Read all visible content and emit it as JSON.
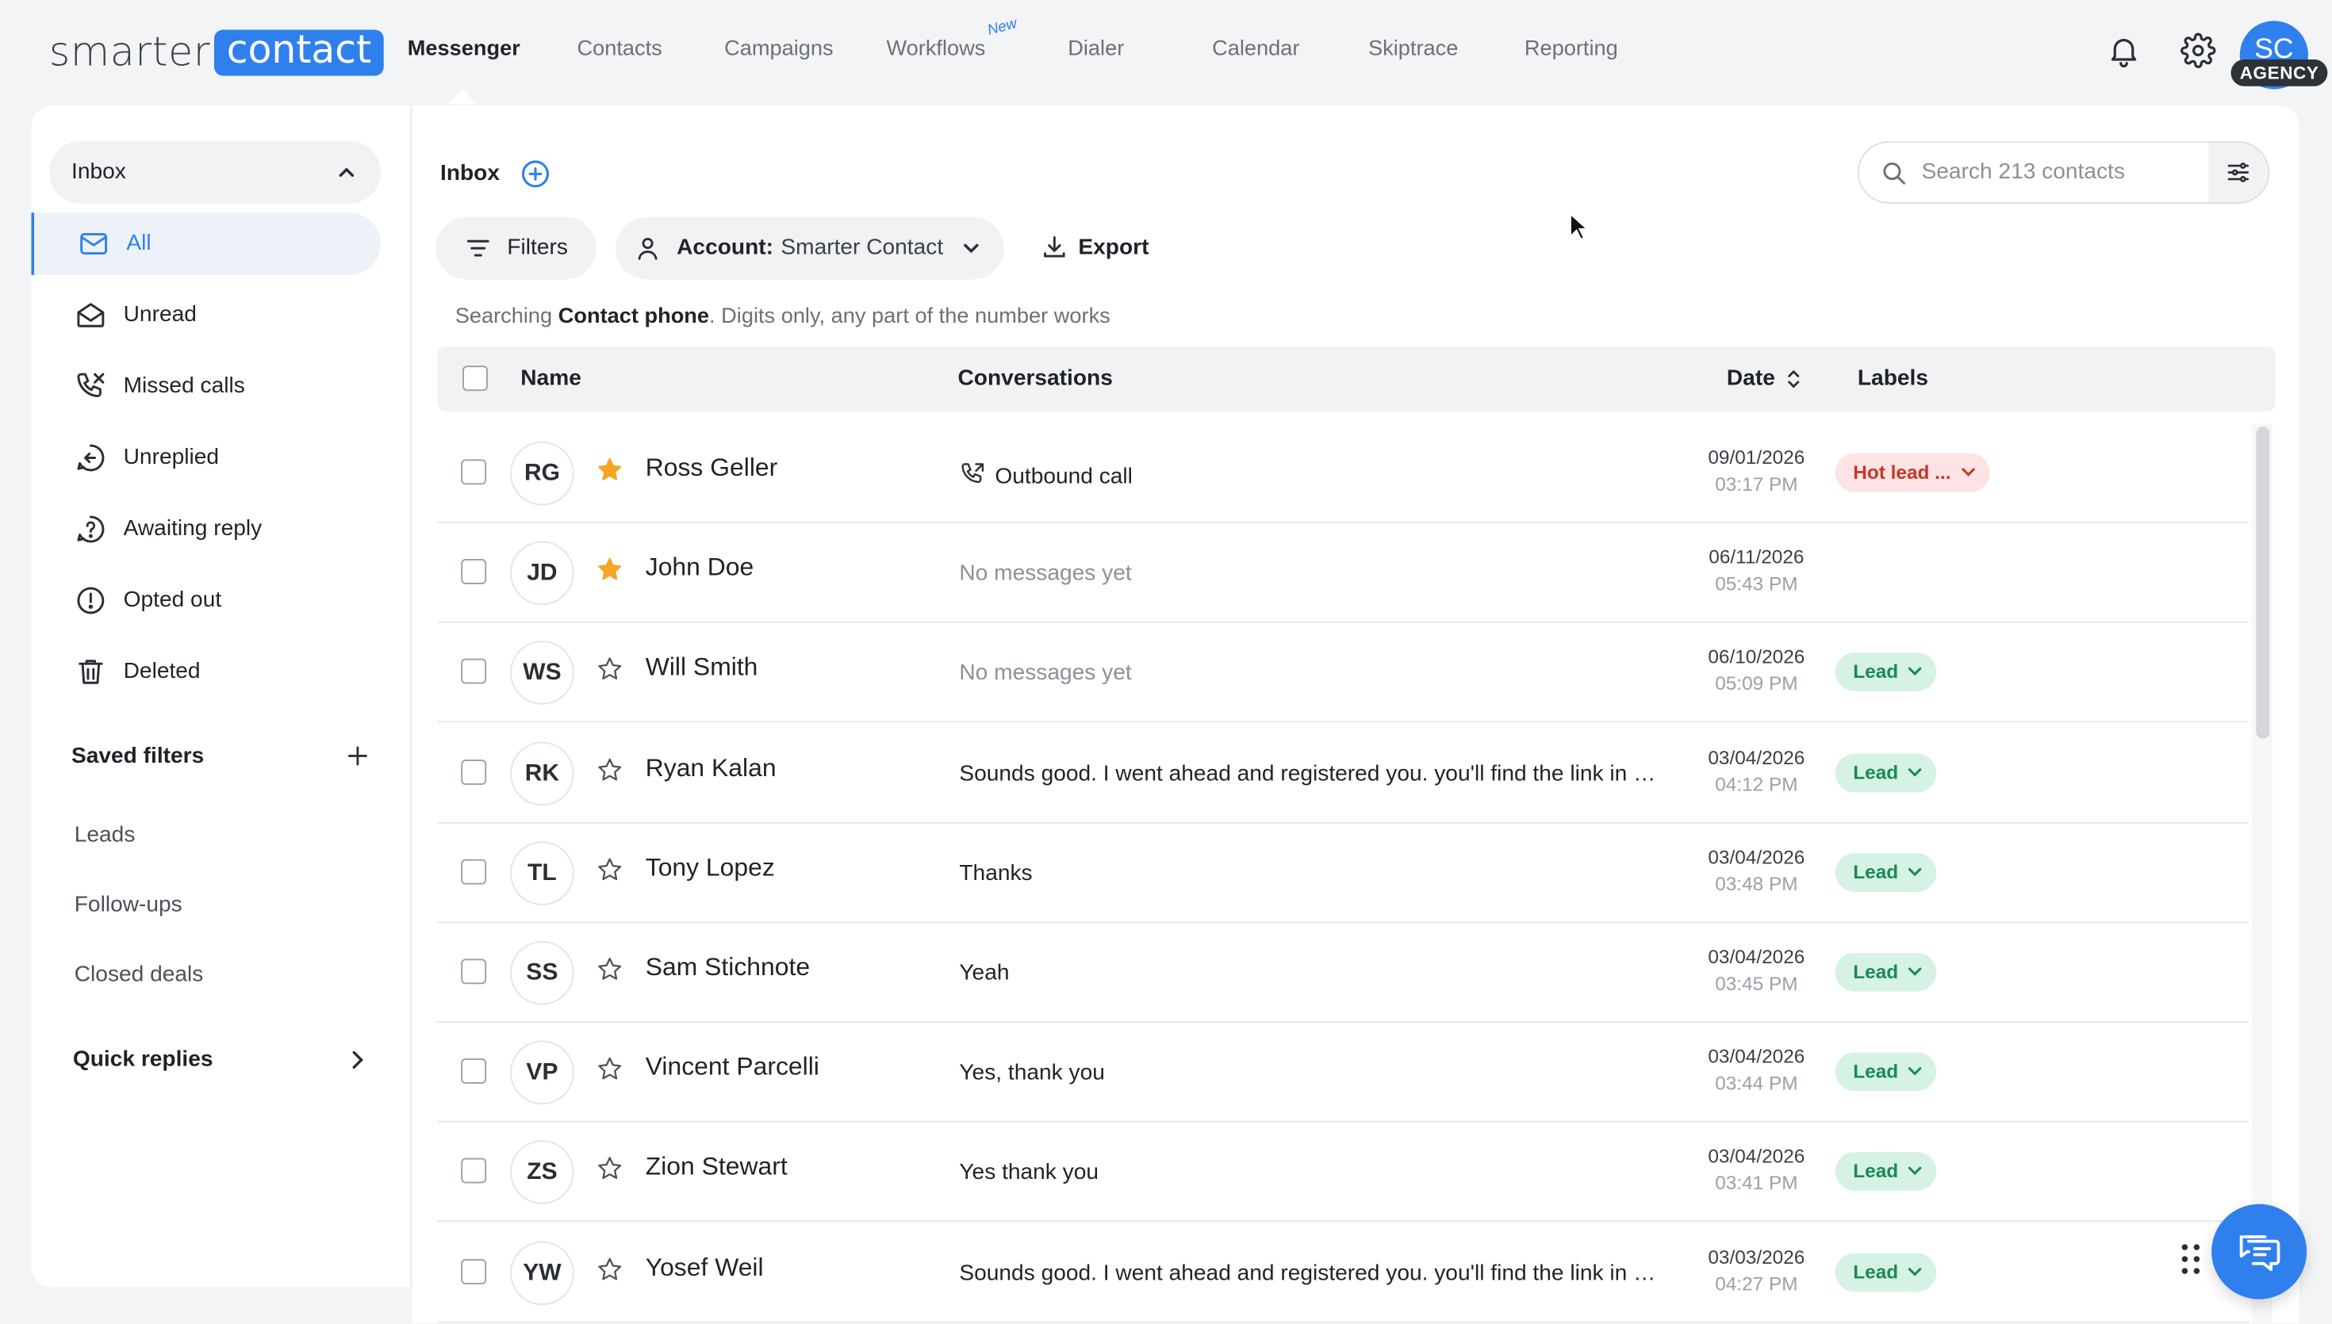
{
  "brand": {
    "part1": "smarter",
    "part2": "contact",
    "accent": "#2f80ed"
  },
  "nav": {
    "items": [
      "Messenger",
      "Contacts",
      "Campaigns",
      "Workflows",
      "Dialer",
      "Calendar",
      "Skiptrace",
      "Reporting"
    ],
    "active": "Messenger",
    "new_badge": "New"
  },
  "user": {
    "initials": "SC",
    "badge": "AGENCY"
  },
  "sidebar": {
    "inbox_label": "Inbox",
    "items": [
      {
        "label": "All",
        "icon": "mail-icon"
      },
      {
        "label": "Unread",
        "icon": "mail-open-icon"
      },
      {
        "label": "Missed calls",
        "icon": "missed-call-icon"
      },
      {
        "label": "Unreplied",
        "icon": "reply-icon"
      },
      {
        "label": "Awaiting reply",
        "icon": "question-icon"
      },
      {
        "label": "Opted out",
        "icon": "alert-icon"
      },
      {
        "label": "Deleted",
        "icon": "trash-icon"
      }
    ],
    "saved_filters_title": "Saved filters",
    "saved_filters": [
      "Leads",
      "Follow-ups",
      "Closed deals"
    ],
    "quick_replies_title": "Quick replies"
  },
  "main": {
    "title": "Inbox",
    "search_placeholder": "Search 213 contacts",
    "filters_label": "Filters",
    "account_label": "Account:",
    "account_value": "Smarter Contact",
    "export_label": "Export",
    "hint_prefix": "Searching ",
    "hint_bold": "Contact phone",
    "hint_suffix": ". Digits only, any part of the number works",
    "columns": {
      "name": "Name",
      "conversations": "Conversations",
      "date": "Date",
      "labels": "Labels"
    }
  },
  "rows": [
    {
      "initials": "RG",
      "name": "Ross Geller",
      "starred": true,
      "message": "Outbound call",
      "call": true,
      "date": "09/01/2026",
      "time": "03:17 PM",
      "label": "Hot lead ...",
      "label_type": "hot"
    },
    {
      "initials": "JD",
      "name": "John Doe",
      "starred": true,
      "message": "No messages yet",
      "empty": true,
      "date": "06/11/2026",
      "time": "05:43 PM",
      "label": "",
      "label_type": ""
    },
    {
      "initials": "WS",
      "name": "Will Smith",
      "starred": false,
      "message": "No messages yet",
      "empty": true,
      "date": "06/10/2026",
      "time": "05:09 PM",
      "label": "Lead",
      "label_type": "lead"
    },
    {
      "initials": "RK",
      "name": "Ryan Kalan",
      "starred": false,
      "message": "Sounds good. I went ahead and registered you. you'll find the link in your email",
      "date": "03/04/2026",
      "time": "04:12 PM",
      "label": "Lead",
      "label_type": "lead"
    },
    {
      "initials": "TL",
      "name": "Tony Lopez",
      "starred": false,
      "message": "Thanks",
      "date": "03/04/2026",
      "time": "03:48 PM",
      "label": "Lead",
      "label_type": "lead"
    },
    {
      "initials": "SS",
      "name": "Sam Stichnote",
      "starred": false,
      "message": "Yeah",
      "date": "03/04/2026",
      "time": "03:45 PM",
      "label": "Lead",
      "label_type": "lead"
    },
    {
      "initials": "VP",
      "name": "Vincent Parcelli",
      "starred": false,
      "message": "Yes, thank you",
      "date": "03/04/2026",
      "time": "03:44 PM",
      "label": "Lead",
      "label_type": "lead"
    },
    {
      "initials": "ZS",
      "name": "Zion Stewart",
      "starred": false,
      "message": "Yes thank you",
      "date": "03/04/2026",
      "time": "03:41 PM",
      "label": "Lead",
      "label_type": "lead"
    },
    {
      "initials": "YW",
      "name": "Yosef Weil",
      "starred": false,
      "message": "Sounds good. I went ahead and registered you. you'll find the link in your email",
      "date": "03/03/2026",
      "time": "04:27 PM",
      "label": "Lead",
      "label_type": "lead"
    }
  ]
}
